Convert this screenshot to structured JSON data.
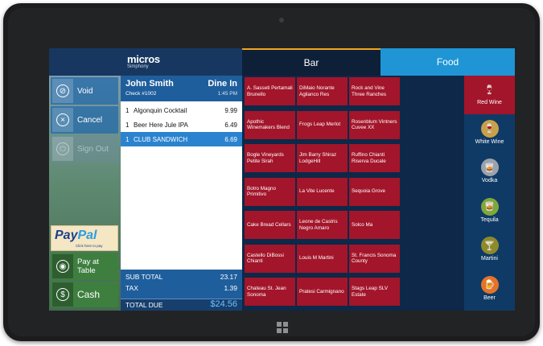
{
  "brand": {
    "name": "micros",
    "sub": "Simphony"
  },
  "tabs": {
    "bar": "Bar",
    "food": "Food"
  },
  "actions": {
    "void": "Void",
    "cancel": "Cancel",
    "sign_out": "Sign Out",
    "pay_at_table_1": "Pay at",
    "pay_at_table_2": "Table",
    "cash": "Cash"
  },
  "paypal": {
    "word_a": "Pay",
    "word_b": "Pal",
    "sub": "Click here to pay"
  },
  "check": {
    "guest": "John Smith",
    "order_type": "Dine In",
    "number": "Check #1002",
    "time": "1:45 PM",
    "items": [
      {
        "qty": "1",
        "name": "Algonquin Cocktail",
        "price": "9.99"
      },
      {
        "qty": "1",
        "name": "Beer Here Jule IPA",
        "price": "6.49"
      },
      {
        "qty": "1",
        "name": "CLUB SANDWICH",
        "price": "6.69"
      }
    ],
    "subtotal_label": "SUB TOTAL",
    "subtotal": "23.17",
    "tax_label": "TAX",
    "tax": "1.39",
    "due_label": "TOTAL DUE",
    "due": "$24.56"
  },
  "wines": [
    [
      "A. Sasseti Pertamali Brunello",
      "DiMaio Norante Aglianco Res",
      "Rock and Vine Three Ranches"
    ],
    [
      "Apothic Winemakers Blend",
      "Frogs Leap Merlot",
      "Rosenblum Vintners Cuvee XX"
    ],
    [
      "Bogle Vineyards Petite Sirah",
      "Jim Barry Shiraz LodgeHill",
      "Ruffino Chianti Riserva Ducale"
    ],
    [
      "Botro Magno Primitivo",
      "La Vite Lucente",
      "Sequoia Grove"
    ],
    [
      "Cake Bread Cellars",
      "Leone de Castris Negro Amaro",
      "Solco Ma"
    ],
    [
      "Castello DiBossi Chianti",
      "Louis M Martini",
      "St. Francis Sonoma County"
    ],
    [
      "Chateau St. Jean Sonoma",
      "Pratesi Carmignano",
      "Stags Leap SLV Estate"
    ]
  ],
  "categories": [
    {
      "label": "Red Wine",
      "icon": "wine-glass-icon",
      "color": "#a3152a"
    },
    {
      "label": "White Wine",
      "icon": "white-wine-icon",
      "color": "#c9a04a"
    },
    {
      "label": "Vodka",
      "icon": "vodka-glass-icon",
      "color": "#9aa3ad"
    },
    {
      "label": "Tequila",
      "icon": "tequila-glass-icon",
      "color": "#7fa83a"
    },
    {
      "label": "Martini",
      "icon": "martini-glass-icon",
      "color": "#8e8a2a"
    },
    {
      "label": "Beer",
      "icon": "beer-glass-icon",
      "color": "#e4732a"
    }
  ],
  "colors": {
    "accent": "#1f95d6",
    "wine_red": "#a3152a",
    "check_blue": "#1f5e9c",
    "pay_green": "#3e7f40"
  }
}
